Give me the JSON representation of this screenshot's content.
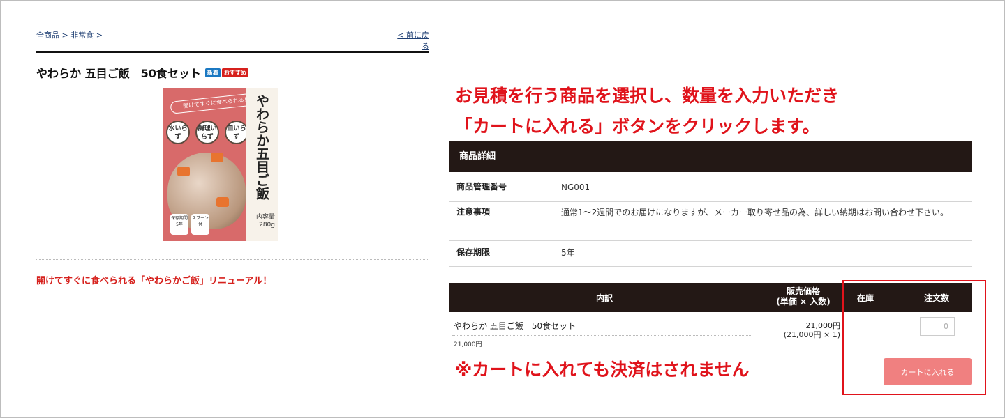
{
  "breadcrumb": {
    "all_products": "全商品",
    "sep1": " > ",
    "category": "非常食",
    "sep2": " >"
  },
  "back_link": "< 前に戻る",
  "product": {
    "title": "やわらか 五目ご飯　50食セット",
    "badge_new": "新着",
    "badge_recommended": "おすすめ",
    "image": {
      "band_text": "開けてすぐに食べられる！",
      "label_text": "やわらか五目ご飯",
      "circles": [
        "水いらず",
        "調理いらず",
        "皿いらず"
      ],
      "foot1": "保存期間5年",
      "foot2": "スプーン付",
      "weight": "内容量280g"
    },
    "promo": "開けてすぐに食べられる「やわらかご飯」リニューアル！"
  },
  "instruction": {
    "line1": "お見積を行う商品を選択し、数量を入力いただき",
    "line2": "「カートに入れる」ボタンをクリックします。"
  },
  "details": {
    "heading": "商品詳細",
    "rows": [
      {
        "key": "商品管理番号",
        "value": "NG001"
      },
      {
        "key": "注意事項",
        "value": "通常1～2週間でのお届けになりますが、メーカー取り寄せ品の為、詳しい納期はお問い合わせ下さい。"
      },
      {
        "key": "保存期限",
        "value": "5年"
      }
    ]
  },
  "order": {
    "headers": {
      "breakdown": "内訳",
      "price_line1": "販売価格",
      "price_line2": "(単価 × 入数)",
      "stock": "在庫",
      "quantity": "注文数"
    },
    "item": {
      "name": "やわらか 五目ご飯　50食セット",
      "unit_price": "21,000円",
      "price": "21,000円",
      "price_detail": "(21,000円 × 1)",
      "quantity": "0"
    },
    "cart_button": "カートに入れる"
  },
  "notice": "※カートに入れても決済はされません",
  "colors": {
    "accent_red": "#e0131b",
    "header_dark": "#231815",
    "button_pink": "#f08080",
    "link_blue": "#1f3f73"
  }
}
